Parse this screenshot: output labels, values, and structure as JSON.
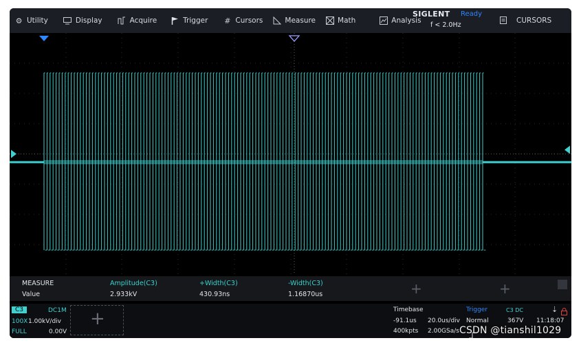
{
  "menu": [
    {
      "label": "Utility",
      "icon": "gear-icon"
    },
    {
      "label": "Display",
      "icon": "monitor-icon"
    },
    {
      "label": "Acquire",
      "icon": "acquire-wave-icon"
    },
    {
      "label": "Trigger",
      "icon": "trigger-flag-icon"
    },
    {
      "label": "Cursors",
      "icon": "cursors-hash-icon"
    },
    {
      "label": "Measure",
      "icon": "measure-ruler-icon"
    },
    {
      "label": "Math",
      "icon": "math-icon"
    },
    {
      "label": "Analysis",
      "icon": "analysis-icon"
    }
  ],
  "status": {
    "brand": "SIGLENT",
    "state": "Ready",
    "frequency": "f < 2.0Hz"
  },
  "cursors_button": {
    "label": "CURSORS",
    "icon": "clipboard-icon"
  },
  "measure": {
    "title": "MEASURE",
    "row_label": "Value",
    "columns": [
      {
        "name": "Amplitude(C3)",
        "value": "2.933kV"
      },
      {
        "name": "+Width(C3)",
        "value": "430.93ns"
      },
      {
        "name": "-Width(C3)",
        "value": "1.16870us"
      }
    ]
  },
  "channel": {
    "name": "C3",
    "coupling": "DC1M",
    "probe": "100X",
    "scale": "1.00kV/div",
    "bandwidth": "FULL",
    "offset": "0.00V"
  },
  "timebase": {
    "title": "Timebase",
    "delay": "-91.1us",
    "scale": "20.0us/div",
    "points": "400kpts",
    "sample_rate": "2.00GSa/s"
  },
  "trigger": {
    "title": "Trigger",
    "source": "C3 DC",
    "mode": "Normal",
    "level": "367V"
  },
  "clock": {
    "time": "11:18:07"
  },
  "watermark": "CSDN @tianshil1029",
  "colors": {
    "trace": "#3fd1cf",
    "accent": "#2f86ff",
    "background": "#000000"
  }
}
